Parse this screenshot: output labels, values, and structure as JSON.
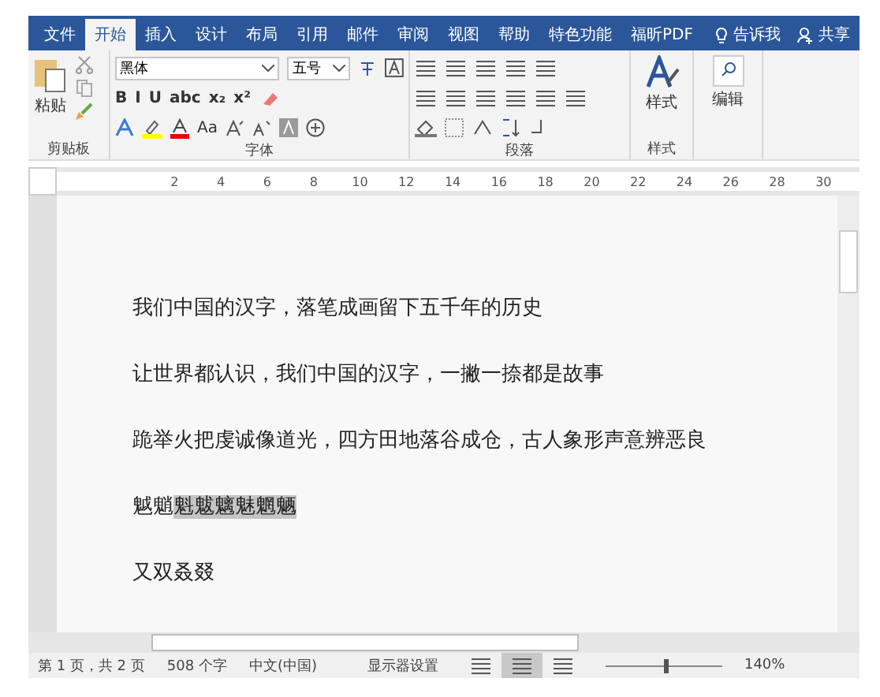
{
  "ribbon_tabs": [
    {
      "label": "文件",
      "selected": false
    },
    {
      "label": "开始",
      "selected": true
    },
    {
      "label": "插入",
      "selected": false
    },
    {
      "label": "设计",
      "selected": false
    },
    {
      "label": "布局",
      "selected": false
    },
    {
      "label": "引用",
      "selected": false
    },
    {
      "label": "邮件",
      "selected": false
    },
    {
      "label": "审阅",
      "selected": false
    },
    {
      "label": "视图",
      "selected": false
    },
    {
      "label": "帮助",
      "selected": false
    },
    {
      "label": "特色功能",
      "selected": false
    },
    {
      "label": "福昕PDF",
      "selected": false
    }
  ],
  "tell_me": "告诉我",
  "share": "共享",
  "clipboard": {
    "paste": "粘贴",
    "group_label": "剪贴板"
  },
  "font": {
    "name": "黑体",
    "size": "五号",
    "format_buttons": [
      "B",
      "I",
      "U",
      "abc",
      "x₂",
      "x²"
    ],
    "case_button": "Aa",
    "group_label": "字体"
  },
  "paragraph": {
    "group_label": "段落"
  },
  "styles": {
    "button": "样式",
    "group_label": "样式"
  },
  "editing": {
    "button": "编辑"
  },
  "ruler_marks": [
    "2",
    "4",
    "6",
    "8",
    "10",
    "12",
    "14",
    "16",
    "18",
    "20",
    "22",
    "24",
    "26",
    "28",
    "30"
  ],
  "document_lines": [
    {
      "text": "我们中国的汉字，落笔成画留下五千年的历史"
    },
    {
      "text": "让世界都认识，我们中国的汉字，一撇一捺都是故事"
    },
    {
      "text": "跪举火把虔诚像道光，四方田地落谷成仓，古人象形声意辨恶良"
    },
    {
      "text": "魆魈",
      "selected_text": "魁魃魑魅魍魉"
    },
    {
      "text": "又双叒叕"
    }
  ],
  "status_bar": {
    "page": "第 1 页，共 2 页",
    "words": "508 个字",
    "language": "中文(中国)",
    "display_settings": "显示器设置",
    "zoom": {
      "level": 0.5,
      "reading": "140%"
    }
  }
}
